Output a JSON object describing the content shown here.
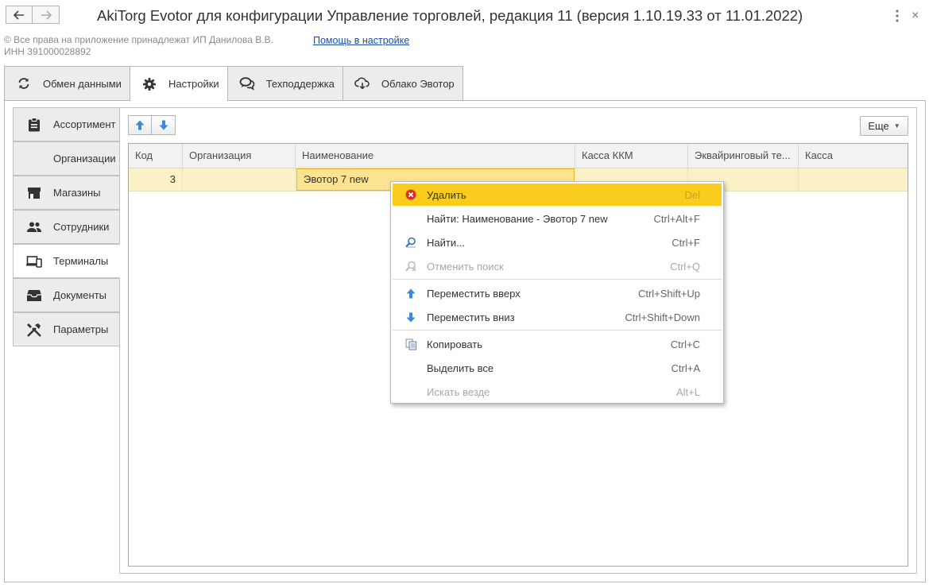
{
  "window": {
    "title": "AkiTorg Evotor для конфигурации Управление торговлей, редакция 11 (версия 1.10.19.33 от 11.01.2022)",
    "back_icon": "arrow-left-icon",
    "forward_icon": "arrow-right-icon",
    "menu_icon": "more-vertical-icon",
    "close_label": "×"
  },
  "header": {
    "copyright_line1": "© Все права на приложение принадлежат ИП Данилова В.В.",
    "copyright_line2": "ИНН 391000028892",
    "help_link": "Помощь в настройке"
  },
  "top_tabs": [
    {
      "label": "Обмен данными",
      "icon": "sync-icon"
    },
    {
      "label": "Настройки",
      "icon": "gear-icon",
      "active": true
    },
    {
      "label": "Техподдержка",
      "icon": "chat-bubbles-icon"
    },
    {
      "label": "Облако Эвотор",
      "icon": "cloud-icon"
    }
  ],
  "side_tabs": [
    {
      "label": "Ассортимент",
      "icon": "clipboard-icon"
    },
    {
      "label": "Организации",
      "icon": ""
    },
    {
      "label": "Магазины",
      "icon": "store-icon"
    },
    {
      "label": "Сотрудники",
      "icon": "people-icon"
    },
    {
      "label": "Терминалы",
      "icon": "devices-icon",
      "active": true
    },
    {
      "label": "Документы",
      "icon": "inbox-tray-icon"
    },
    {
      "label": "Параметры",
      "icon": "tools-icon"
    }
  ],
  "toolbar": {
    "move_up_icon": "arrow-up-icon",
    "move_down_icon": "arrow-down-icon",
    "more_label": "Еще"
  },
  "table": {
    "columns": [
      "Код",
      "Организация",
      "Наименование",
      "Касса ККМ",
      "Эквайринговый те...",
      "Касса"
    ],
    "rows": [
      {
        "code": "3",
        "organization": "",
        "name": "Эвотор 7 new",
        "kkm": "",
        "acquiring": "",
        "cash": ""
      }
    ]
  },
  "context_menu": {
    "items": [
      {
        "label": "Удалить",
        "shortcut": "Del",
        "icon": "delete-icon",
        "highlighted": true
      },
      {
        "label": "Найти: Наименование - Эвотор 7 new",
        "shortcut": "Ctrl+Alt+F",
        "icon": ""
      },
      {
        "label": "Найти...",
        "shortcut": "Ctrl+F",
        "icon": "search-icon"
      },
      {
        "label": "Отменить поиск",
        "shortcut": "Ctrl+Q",
        "icon": "cancel-search-icon",
        "disabled": true
      },
      {
        "label": "Переместить вверх",
        "shortcut": "Ctrl+Shift+Up",
        "icon": "arrow-up-icon"
      },
      {
        "label": "Переместить вниз",
        "shortcut": "Ctrl+Shift+Down",
        "icon": "arrow-down-icon"
      },
      {
        "label": "Копировать",
        "shortcut": "Ctrl+C",
        "icon": "copy-icon"
      },
      {
        "label": "Выделить все",
        "shortcut": "Ctrl+A",
        "icon": ""
      },
      {
        "label": "Искать везде",
        "shortcut": "Alt+L",
        "icon": "",
        "disabled": true
      }
    ]
  },
  "colors": {
    "selection_row": "#fbf1c7",
    "menu_highlight": "#f9cc1e",
    "arrow_blue": "#3b8ad9",
    "delete_red": "#d9302c",
    "link_blue": "#1c4da6"
  }
}
